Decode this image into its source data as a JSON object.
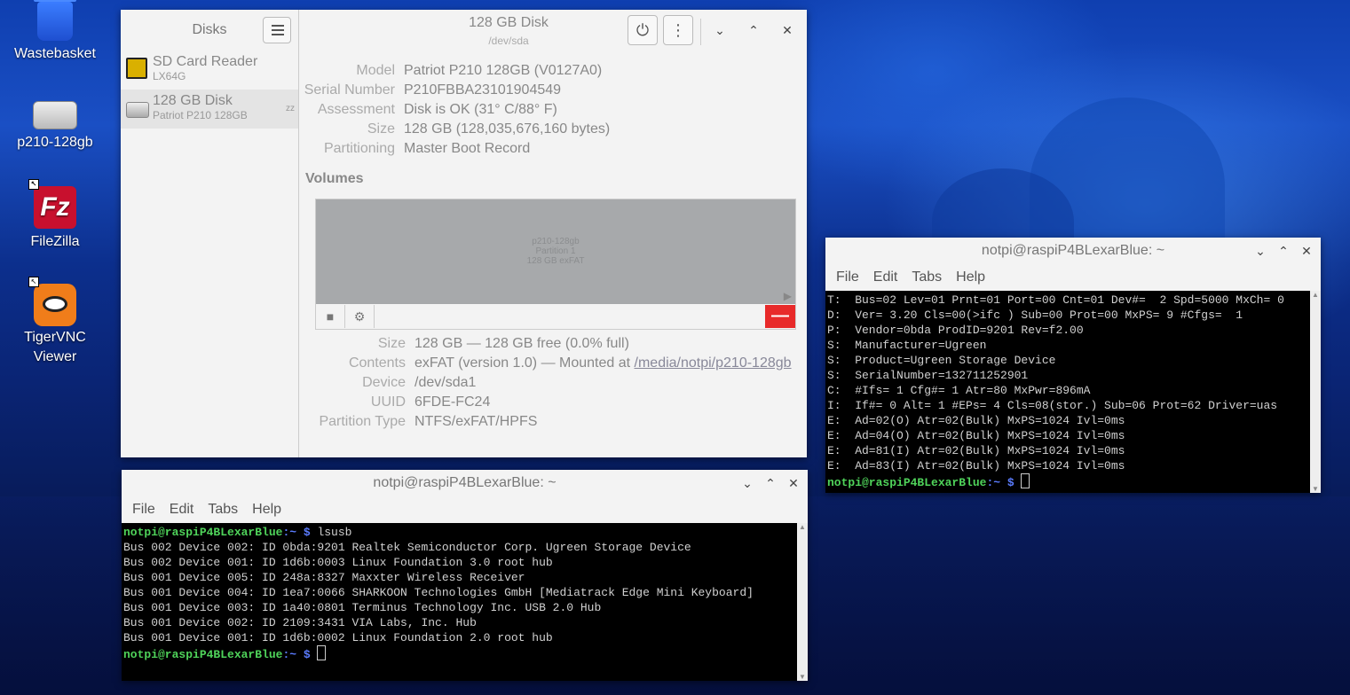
{
  "desktop": {
    "icons": [
      {
        "label": "Wastebasket"
      },
      {
        "label": "p210-128gb"
      },
      {
        "label": "FileZilla"
      },
      {
        "label": "TigerVNC\nViewer"
      }
    ]
  },
  "disks": {
    "sidebar_title": "Disks",
    "drives": [
      {
        "name": "SD Card Reader",
        "sub": "LX64G"
      },
      {
        "name": "128 GB Disk",
        "sub": "Patriot P210 128GB"
      }
    ],
    "title": "128 GB Disk",
    "subtitle": "/dev/sda",
    "info": [
      {
        "k": "Model",
        "v": "Patriot P210 128GB (V0127A0)"
      },
      {
        "k": "Serial Number",
        "v": "P210FBBA23101904549"
      },
      {
        "k": "Assessment",
        "v": "Disk is OK (31° C/88° F)"
      },
      {
        "k": "Size",
        "v": "128 GB (128,035,676,160 bytes)"
      },
      {
        "k": "Partitioning",
        "v": "Master Boot Record"
      }
    ],
    "volumes_label": "Volumes",
    "partition": {
      "line1": "p210-128gb",
      "line2": "Partition 1",
      "line3": "128 GB exFAT"
    },
    "vol_info": [
      {
        "k": "Size",
        "v": "128 GB — 128 GB free (0.0% full)"
      },
      {
        "k": "Contents",
        "v": "exFAT (version 1.0) — Mounted at ",
        "link": "/media/notpi/p210-128gb"
      },
      {
        "k": "Device",
        "v": "/dev/sda1"
      },
      {
        "k": "UUID",
        "v": "6FDE-FC24"
      },
      {
        "k": "Partition Type",
        "v": "NTFS/exFAT/HPFS"
      }
    ]
  },
  "term1": {
    "title": "notpi@raspiP4BLexarBlue: ~",
    "menu": [
      "File",
      "Edit",
      "Tabs",
      "Help"
    ],
    "prompt_user": "notpi@raspiP4BLexarBlue",
    "prompt_path": ":~ $",
    "command": " lsusb",
    "lines": [
      "Bus 002 Device 002: ID 0bda:9201 Realtek Semiconductor Corp. Ugreen Storage Device",
      "Bus 002 Device 001: ID 1d6b:0003 Linux Foundation 3.0 root hub",
      "Bus 001 Device 005: ID 248a:8327 Maxxter Wireless Receiver",
      "Bus 001 Device 004: ID 1ea7:0066 SHARKOON Technologies GmbH [Mediatrack Edge Mini Keyboard]",
      "Bus 001 Device 003: ID 1a40:0801 Terminus Technology Inc. USB 2.0 Hub",
      "Bus 001 Device 002: ID 2109:3431 VIA Labs, Inc. Hub",
      "Bus 001 Device 001: ID 1d6b:0002 Linux Foundation 2.0 root hub"
    ]
  },
  "term2": {
    "title": "notpi@raspiP4BLexarBlue: ~",
    "menu": [
      "File",
      "Edit",
      "Tabs",
      "Help"
    ],
    "prompt_user": "notpi@raspiP4BLexarBlue",
    "prompt_path": ":~ $",
    "lines": [
      "T:  Bus=02 Lev=01 Prnt=01 Port=00 Cnt=01 Dev#=  2 Spd=5000 MxCh= 0",
      "D:  Ver= 3.20 Cls=00(>ifc ) Sub=00 Prot=00 MxPS= 9 #Cfgs=  1",
      "P:  Vendor=0bda ProdID=9201 Rev=f2.00",
      "S:  Manufacturer=Ugreen",
      "S:  Product=Ugreen Storage Device",
      "S:  SerialNumber=132711252901",
      "C:  #Ifs= 1 Cfg#= 1 Atr=80 MxPwr=896mA",
      "I:  If#= 0 Alt= 1 #EPs= 4 Cls=08(stor.) Sub=06 Prot=62 Driver=uas",
      "E:  Ad=02(O) Atr=02(Bulk) MxPS=1024 Ivl=0ms",
      "E:  Ad=04(O) Atr=02(Bulk) MxPS=1024 Ivl=0ms",
      "E:  Ad=81(I) Atr=02(Bulk) MxPS=1024 Ivl=0ms",
      "E:  Ad=83(I) Atr=02(Bulk) MxPS=1024 Ivl=0ms"
    ]
  }
}
